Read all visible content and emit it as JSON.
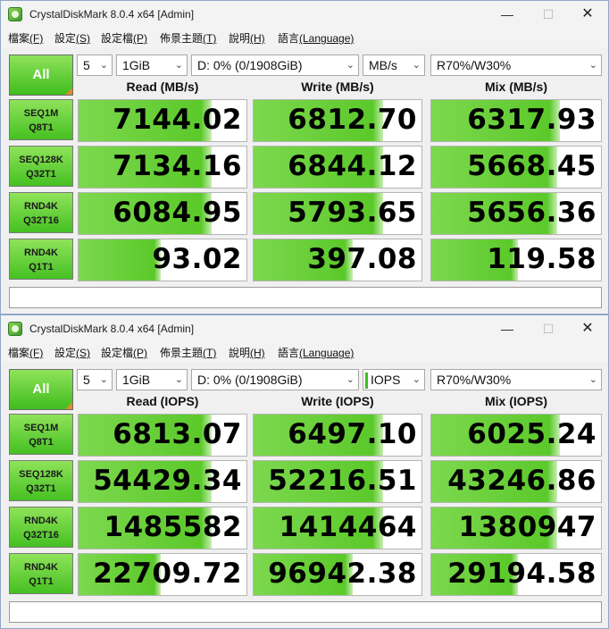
{
  "windows": [
    {
      "title": "CrystalDiskMark 8.0.4 x64 [Admin]",
      "menu": [
        {
          "label": "檔案",
          "key": "(F)"
        },
        {
          "label": "設定",
          "key": "(S)"
        },
        {
          "label": "設定檔",
          "key": "(P)"
        },
        {
          "label": "佈景主題",
          "key": "(T)"
        },
        {
          "label": "說明",
          "key": "(H)"
        },
        {
          "label": "語言",
          "key": "(Language)"
        }
      ],
      "all_label": "All",
      "count": "5",
      "size": "1GiB",
      "drive": "D: 0% (0/1908GiB)",
      "unit": "MB/s",
      "profile": "R70%/W30%",
      "headers": {
        "read": "Read (MB/s)",
        "write": "Write (MB/s)",
        "mix": "Mix (MB/s)"
      },
      "rows": [
        {
          "line1": "SEQ1M",
          "line2": "Q8T1",
          "read": "7144.02",
          "write": "6812.70",
          "mix": "6317.93",
          "read_level": 0.79,
          "write_level": 0.77,
          "mix_level": 0.76
        },
        {
          "line1": "SEQ128K",
          "line2": "Q32T1",
          "read": "7134.16",
          "write": "6844.12",
          "mix": "5668.45",
          "read_level": 0.79,
          "write_level": 0.77,
          "mix_level": 0.74
        },
        {
          "line1": "RND4K",
          "line2": "Q32T16",
          "read": "6084.95",
          "write": "5793.65",
          "mix": "5656.36",
          "read_level": 0.79,
          "write_level": 0.77,
          "mix_level": 0.74
        },
        {
          "line1": "RND4K",
          "line2": "Q1T1",
          "read": "93.02",
          "write": "397.08",
          "mix": "119.58",
          "read_level": 0.49,
          "write_level": 0.59,
          "mix_level": 0.51
        }
      ],
      "comment": ""
    },
    {
      "title": "CrystalDiskMark 8.0.4 x64 [Admin]",
      "menu": [
        {
          "label": "檔案",
          "key": "(F)"
        },
        {
          "label": "設定",
          "key": "(S)"
        },
        {
          "label": "設定檔",
          "key": "(P)"
        },
        {
          "label": "佈景主題",
          "key": "(T)"
        },
        {
          "label": "說明",
          "key": "(H)"
        },
        {
          "label": "語言",
          "key": "(Language)"
        }
      ],
      "all_label": "All",
      "count": "5",
      "size": "1GiB",
      "drive": "D: 0% (0/1908GiB)",
      "unit": "IOPS",
      "profile": "R70%/W30%",
      "headers": {
        "read": "Read (IOPS)",
        "write": "Write (IOPS)",
        "mix": "Mix (IOPS)"
      },
      "rows": [
        {
          "line1": "SEQ1M",
          "line2": "Q8T1",
          "read": "6813.07",
          "write": "6497.10",
          "mix": "6025.24",
          "read_level": 0.79,
          "write_level": 0.77,
          "mix_level": 0.76
        },
        {
          "line1": "SEQ128K",
          "line2": "Q32T1",
          "read": "54429.34",
          "write": "52216.51",
          "mix": "43246.86",
          "read_level": 0.79,
          "write_level": 0.77,
          "mix_level": 0.74
        },
        {
          "line1": "RND4K",
          "line2": "Q32T16",
          "read": "1485582",
          "write": "1414464",
          "mix": "1380947",
          "read_level": 0.79,
          "write_level": 0.77,
          "mix_level": 0.74
        },
        {
          "line1": "RND4K",
          "line2": "Q1T1",
          "read": "22709.72",
          "write": "96942.38",
          "mix": "29194.58",
          "read_level": 0.49,
          "write_level": 0.59,
          "mix_level": 0.51
        }
      ],
      "comment": ""
    }
  ],
  "icons": {
    "app": "crystaldiskmark-icon",
    "minimize": "minimize-icon",
    "maximize": "maximize-icon",
    "close": "close-icon",
    "dropdown": "chevron-down-icon"
  },
  "colors": {
    "accent_green": "#5bc92a",
    "button_green_top": "#8fe35a",
    "window_bg": "#f0f0f0"
  }
}
